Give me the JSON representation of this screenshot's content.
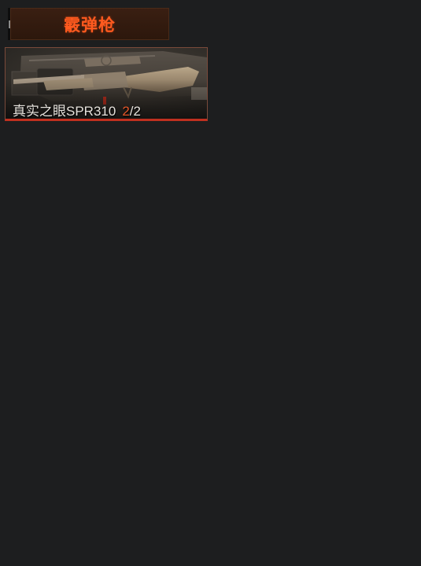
{
  "category": {
    "title": "霰弹枪",
    "title_color": "#ff5a1f"
  },
  "weapons": [
    {
      "name": "真实之眼SPR310",
      "count_current": "2",
      "count_separator": "/",
      "count_total": "2",
      "image": "shotgun-image",
      "accent_color": "#c0301f"
    }
  ]
}
